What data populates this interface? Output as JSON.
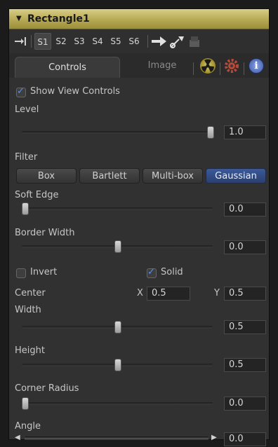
{
  "header": {
    "title": "Rectangle1",
    "collapse_icon": "triangle-down-icon"
  },
  "toolbar": {
    "s1": "S1",
    "s2": "S2",
    "s3": "S3",
    "s4": "S4",
    "s5": "S5",
    "s6": "S6"
  },
  "tabs": {
    "controls": "Controls",
    "image": "Image"
  },
  "controls": {
    "show_view_controls": "Show View Controls",
    "level": {
      "label": "Level",
      "value": "1.0"
    },
    "filter": {
      "label": "Filter",
      "options": [
        "Box",
        "Bartlett",
        "Multi-box",
        "Gaussian"
      ],
      "selected": "Gaussian"
    },
    "soft_edge": {
      "label": "Soft Edge",
      "value": "0.0"
    },
    "border_width": {
      "label": "Border Width",
      "value": "0.0"
    },
    "invert": {
      "label": "Invert"
    },
    "solid": {
      "label": "Solid"
    },
    "center": {
      "label": "Center",
      "x_label": "X",
      "x": "0.5",
      "y_label": "Y",
      "y": "0.5"
    },
    "width": {
      "label": "Width",
      "value": "0.5"
    },
    "height": {
      "label": "Height",
      "value": "0.5"
    },
    "corner_radius": {
      "label": "Corner Radius",
      "value": "0.0"
    },
    "angle": {
      "label": "Angle",
      "value": "0.0"
    }
  },
  "colors": {
    "header_gold": "#c7bb66",
    "selected_blue": "#3b5a9a"
  }
}
